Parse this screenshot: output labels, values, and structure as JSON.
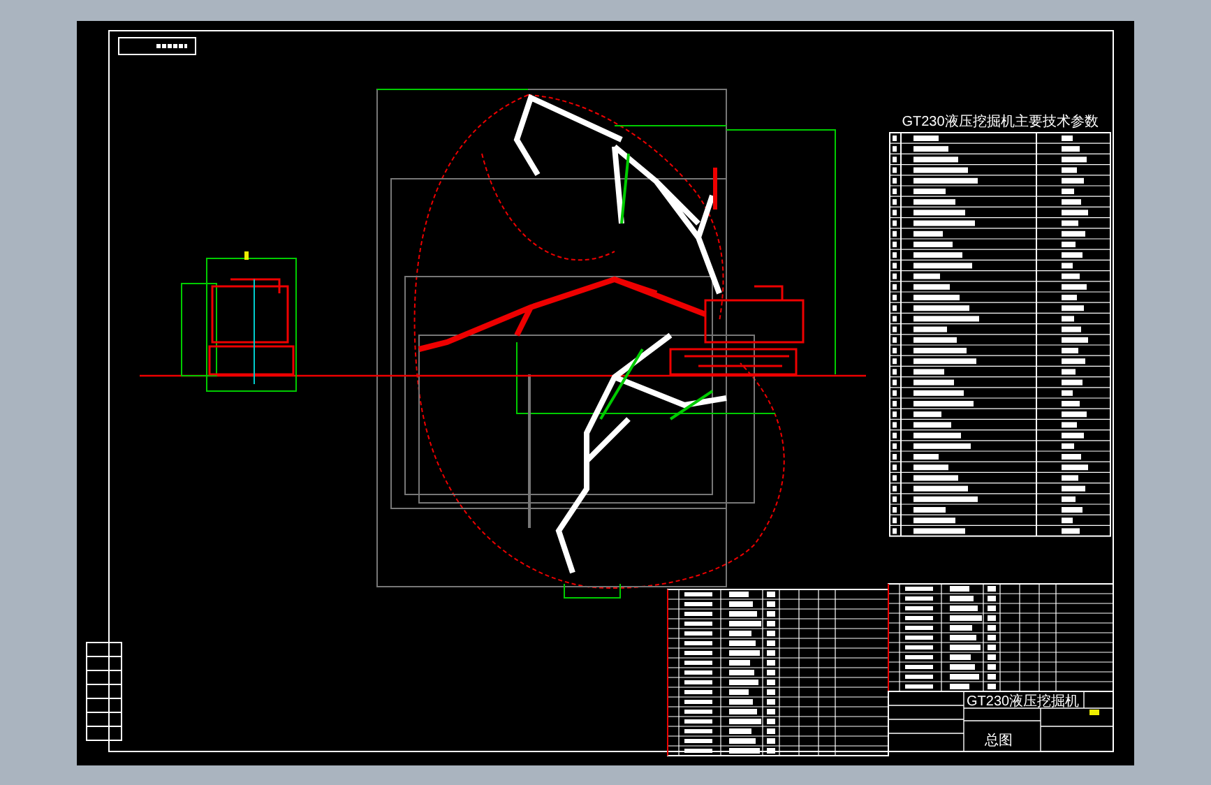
{
  "parameter_table": {
    "title": "GT230液压挖掘机主要技术参数"
  },
  "title_block": {
    "name": "GT230液压挖掘机",
    "drawing_title": "总图"
  }
}
